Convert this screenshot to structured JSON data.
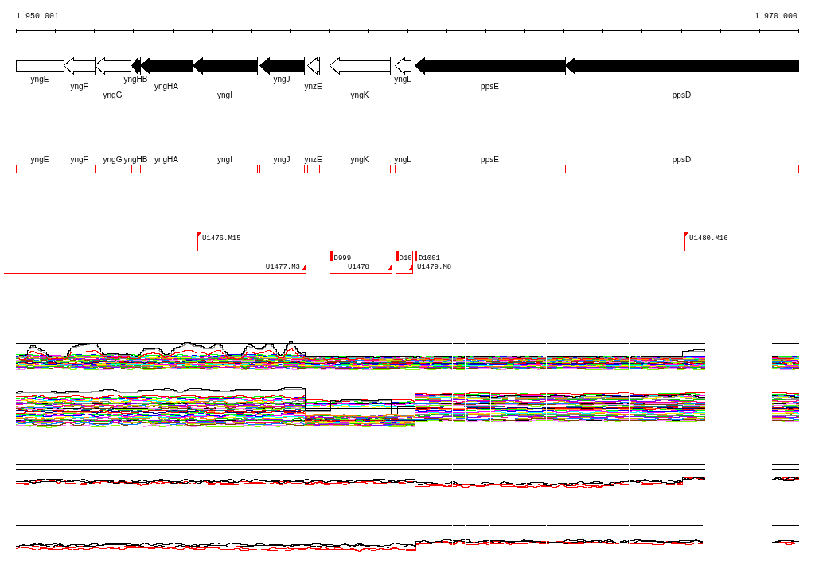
{
  "ruler": {
    "start_label": "1 950 001",
    "end_label": "1 970 000"
  },
  "genes": [
    {
      "name": "yngE",
      "filled": false,
      "kind": "bar"
    },
    {
      "name": "yngF",
      "filled": false,
      "kind": "arrow"
    },
    {
      "name": "yngG",
      "filled": false,
      "kind": "arrow"
    },
    {
      "name": "yngHB",
      "filled": true,
      "kind": "arrow"
    },
    {
      "name": "yngHA",
      "filled": true,
      "kind": "arrow"
    },
    {
      "name": "yngI",
      "filled": true,
      "kind": "arrow"
    },
    {
      "name": "yngJ",
      "filled": true,
      "kind": "arrow"
    },
    {
      "name": "ynzE",
      "filled": false,
      "kind": "arrow"
    },
    {
      "name": "yngK",
      "filled": false,
      "kind": "arrow"
    },
    {
      "name": "yngL",
      "filled": false,
      "kind": "arrow"
    },
    {
      "name": "ppsE",
      "filled": true,
      "kind": "arrow"
    },
    {
      "name": "ppsD",
      "filled": true,
      "kind": "arrow"
    }
  ],
  "gene_regions": [
    {
      "name": "yngE"
    },
    {
      "name": "yngF"
    },
    {
      "name": "yngG"
    },
    {
      "name": "yngHB"
    },
    {
      "name": "yngHA"
    },
    {
      "name": "yngI"
    },
    {
      "name": "yngJ"
    },
    {
      "name": "ynzE"
    },
    {
      "name": "yngK"
    },
    {
      "name": "yngL"
    },
    {
      "name": "ppsE"
    },
    {
      "name": "ppsD"
    }
  ],
  "markers_above": [
    {
      "label": "U1476.M15"
    },
    {
      "label": "U1480.M16"
    }
  ],
  "markers_below": [
    {
      "label": "D999",
      "kind": "flag"
    },
    {
      "label": "D10",
      "kind": "flag"
    },
    {
      "label": "D1001",
      "kind": "flag"
    },
    {
      "label": "U1477.M3",
      "kind": "triangle"
    },
    {
      "label": "U1478",
      "kind": "triangle"
    },
    {
      "label": "U1479.M8",
      "kind": "triangle"
    }
  ],
  "signal_tracks": [
    {
      "kind": "multi"
    },
    {
      "kind": "multi"
    },
    {
      "kind": "pair"
    },
    {
      "kind": "pair"
    }
  ]
}
